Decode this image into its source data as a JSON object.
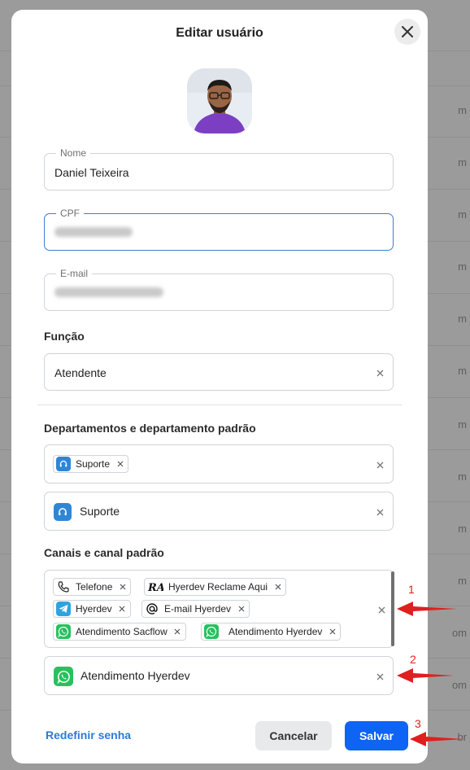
{
  "background": {
    "suffixes": [
      "m",
      "m",
      "m",
      "m",
      "m",
      "m",
      "m",
      "m",
      "m",
      "m",
      "om",
      "m",
      "om",
      "br"
    ]
  },
  "modal": {
    "title": "Editar usuário",
    "close_icon": "close-icon"
  },
  "form": {
    "name": {
      "label": "Nome",
      "value": "Daniel Teixeira"
    },
    "cpf": {
      "label": "CPF"
    },
    "email": {
      "label": "E-mail"
    },
    "role": {
      "section_label": "Função",
      "value": "Atendente"
    },
    "departments": {
      "section_label": "Departamentos e departamento padrão",
      "selected_chips": [
        {
          "label": "Suporte",
          "icon": "headset-icon"
        }
      ],
      "default_value": "Suporte",
      "default_icon": "headset-icon"
    },
    "channels": {
      "section_label": "Canais e canal padrão",
      "selected_chips": [
        {
          "label": "Telefone",
          "icon": "phone-icon"
        },
        {
          "label": "Hyerdev Reclame Aqui",
          "icon": "reclame-aqui-icon"
        },
        {
          "label": "Hyerdev",
          "icon": "telegram-icon"
        },
        {
          "label": "E-mail Hyerdev",
          "icon": "at-sign-icon"
        },
        {
          "label": "Atendimento Sacflow",
          "icon": "whatsapp-icon"
        },
        {
          "label": "Atendimento Hyerdev",
          "icon": "whatsapp-icon"
        }
      ],
      "default_value": "Atendimento Hyerdev",
      "default_icon": "whatsapp-icon"
    }
  },
  "footer": {
    "reset_password": "Redefinir senha",
    "cancel": "Cancelar",
    "save": "Salvar"
  },
  "annotations": [
    "1",
    "2",
    "3"
  ],
  "colors": {
    "primary": "#0f63f5",
    "link": "#2a7bd5",
    "annotation": "#e01f1f",
    "whatsapp": "#27c15f",
    "department": "#2f86d6"
  }
}
